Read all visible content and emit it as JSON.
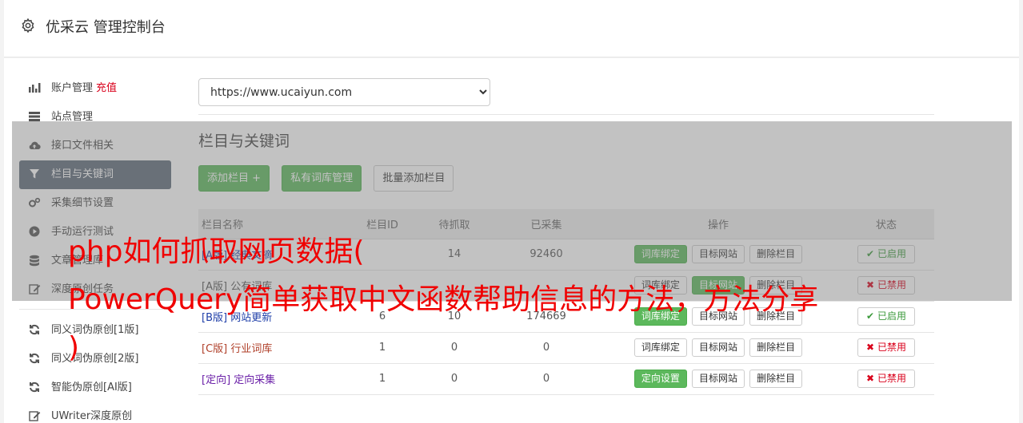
{
  "header": {
    "title": "优采云 管理控制台",
    "icon": "gear-icon"
  },
  "sidebar": {
    "items": [
      {
        "label": "账户管理",
        "badge": "充值",
        "icon": "bar-chart-icon"
      },
      {
        "label": "站点管理",
        "icon": "server-icon"
      },
      {
        "label": "接口文件相关",
        "icon": "cloud-upload-icon"
      },
      {
        "label": "栏目与关键词",
        "icon": "filter-icon",
        "active": true
      },
      {
        "label": "采集细节设置",
        "icon": "cogs-icon"
      },
      {
        "label": "手动运行测试",
        "icon": "play-circle-icon"
      },
      {
        "label": "文章管理库",
        "icon": "database-icon"
      },
      {
        "label": "深度原创任务",
        "icon": "edit-icon"
      }
    ],
    "items2": [
      {
        "label": "同义词伪原创[1版]",
        "icon": "refresh-icon"
      },
      {
        "label": "同义词伪原创[2版]",
        "icon": "refresh-icon"
      },
      {
        "label": "智能伪原创[AI版]",
        "icon": "refresh-icon"
      },
      {
        "label": "UWriter深度原创",
        "icon": "edit-icon"
      }
    ]
  },
  "site_select": {
    "value": "https://www.ucaiyun.com"
  },
  "section": {
    "title": "栏目与关键词"
  },
  "buttons": {
    "add_column": "添加栏目 +",
    "private_lib": "私有词库管理",
    "batch_add": "批量添加栏目"
  },
  "table": {
    "headers": [
      "栏目名称",
      "栏目ID",
      "待抓取",
      "已采集",
      "操作",
      "状态"
    ],
    "rows": [
      {
        "tag": "[A版]",
        "name": "经典文摘",
        "id": "",
        "wait": "14",
        "done": "92460",
        "op1": "词库绑定",
        "op2": "目标网站",
        "op3": "删除栏目",
        "status": "已启用",
        "on": true
      },
      {
        "tag": "[A版]",
        "name": "公有词库",
        "id": "",
        "wait": "",
        "done": "",
        "op1": "词库绑定",
        "op2": "目标网站",
        "op3": "删除栏目",
        "status": "已禁用",
        "on": false
      },
      {
        "tag": "[B版]",
        "name": "网站更新",
        "id": "6",
        "wait": "10",
        "done": "174669",
        "op1": "词库绑定",
        "op2": "目标网站",
        "op3": "删除栏目",
        "status": "已启用",
        "on": true
      },
      {
        "tag": "[C版]",
        "name": "行业词库",
        "id": "1",
        "wait": "0",
        "done": "0",
        "op1": "词库绑定",
        "op2": "目标网站",
        "op3": "删除栏目",
        "status": "已禁用",
        "on": false
      },
      {
        "tag": "[定向]",
        "name": "定向采集",
        "id": "1",
        "wait": "0",
        "done": "0",
        "op1": "定向设置",
        "op2": "目标网站",
        "op3": "删除栏目",
        "status": "已禁用",
        "on": false
      }
    ]
  },
  "headline": {
    "line1": "php如何抓取网页数据(",
    "line2": "PowerQuery简单获取中文函数帮助信息的方法，方法分享",
    "line3": ")"
  }
}
